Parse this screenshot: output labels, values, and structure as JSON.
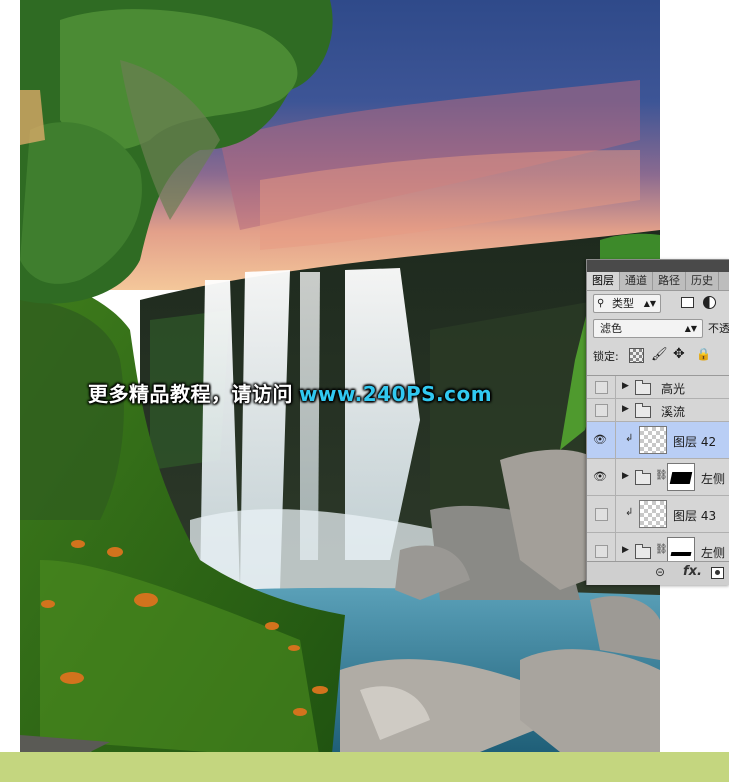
{
  "canvas": {
    "watermark": {
      "chinese_text": "更多精品教程，请访问",
      "url": "www.240PS.com"
    }
  },
  "layers_panel": {
    "tabs": [
      {
        "label": "图层",
        "active": true
      },
      {
        "label": "通道",
        "active": false
      },
      {
        "label": "路径",
        "active": false
      },
      {
        "label": "历史",
        "active": false
      }
    ],
    "filter": {
      "search_glyph": "⚲",
      "value": "类型"
    },
    "blend_mode": "滤色",
    "opacity_label": "不透",
    "lock_label": "锁定:",
    "layers": [
      {
        "name": "高光",
        "kind": "group",
        "visible": false
      },
      {
        "name": "溪流",
        "kind": "group",
        "visible": false
      },
      {
        "name": "图层 42",
        "kind": "layer",
        "visible": true,
        "selected": true,
        "clipped": true
      },
      {
        "name": "左侧",
        "kind": "group-with-mask",
        "visible": true
      },
      {
        "name": "图层 43",
        "kind": "layer",
        "visible": false,
        "clipped": true
      },
      {
        "name": "左侧",
        "kind": "group-with-mask",
        "visible": false
      }
    ],
    "footer": {
      "link_glyph": "⊝",
      "fx_label": "fx."
    }
  },
  "colors": {
    "watermark_url": "#31c9f1",
    "selected_layer": "#b9cef5",
    "panel_bg": "#d6d6d6",
    "page_bottom": "#c4d67f"
  }
}
